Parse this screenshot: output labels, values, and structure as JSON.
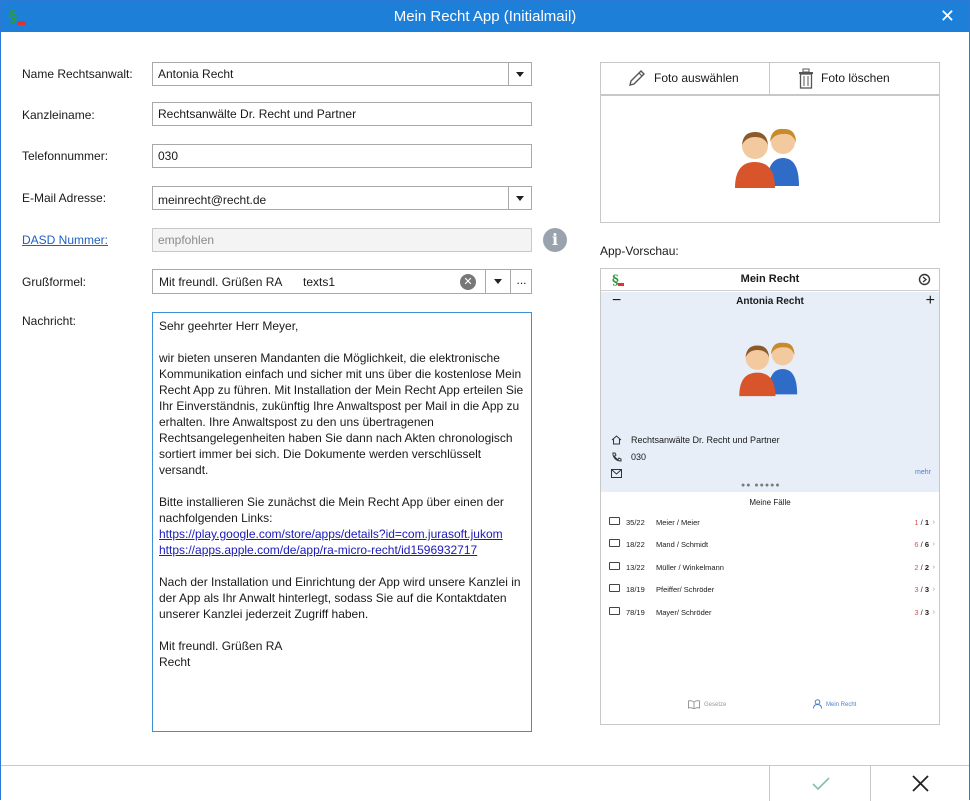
{
  "window": {
    "title": "Mein Recht App (Initialmail)",
    "close_icon": "close-icon"
  },
  "form": {
    "name_label": "Name Rechtsanwalt:",
    "name_value": "Antonia Recht",
    "kanzlei_label": "Kanzleiname:",
    "kanzlei_value": "Rechtsanwälte Dr. Recht und Partner",
    "telefon_label": "Telefonnummer:",
    "telefon_value": "030",
    "email_label": "E-Mail Adresse:",
    "email_value": "meinrecht@recht.de",
    "dasd_label": "DASD Nummer:",
    "dasd_placeholder": "empfohlen",
    "gruss_label": "Grußformel:",
    "gruss_value": "Mit freundl. Grüßen RA",
    "gruss_suffix": "texts1",
    "gruss_more": "...",
    "nachricht_label": "Nachricht:"
  },
  "message": {
    "greeting": "Sehr geehrter Herr Meyer,",
    "para1": "wir bieten unseren Mandanten die Möglichkeit, die elektronische Kommunikation einfach und sicher mit uns über die kostenlose Mein Recht App zu führen. Mit Installation der Mein Recht App erteilen Sie Ihr Einverständnis, zukünftig Ihre Anwaltspost per Mail in die App zu erhalten. Ihre Anwaltspost zu den uns übertragenen Rechtsangelegenheiten haben Sie dann nach Akten chronologisch sortiert immer bei sich. Die Dokumente werden verschlüsselt versandt.",
    "para2": "Bitte installieren Sie zunächst die Mein Recht App über einen der nachfolgenden Links:",
    "link1": "https://play.google.com/store/apps/details?id=com.jurasoft.jukom",
    "link2": "https://apps.apple.com/de/app/ra-micro-recht/id1596932717",
    "para3": "Nach der Installation und Einrichtung der App wird unsere Kanzlei in der App als Ihr Anwalt hinterlegt, sodass Sie auf die Kontaktdaten unserer Kanzlei jederzeit Zugriff haben.",
    "closing": "Mit freundl. Grüßen RA",
    "signature": "Recht"
  },
  "photo": {
    "select_label": "Foto auswählen",
    "delete_label": "Foto löschen"
  },
  "preview": {
    "label": "App-Vorschau:",
    "app_title": "Mein Recht",
    "lawyer": "Antonia Recht",
    "kanzlei": "Rechtsanwälte Dr. Recht und Partner",
    "telefon": "030",
    "mehr": "mehr",
    "cases_title": "Meine Fälle",
    "cases": [
      {
        "nr": "35/22",
        "name": "Meier / Meier",
        "open": "1",
        "total": "1"
      },
      {
        "nr": "18/22",
        "name": "Mand / Schmidt",
        "open": "6",
        "total": "6"
      },
      {
        "nr": "13/22",
        "name": "Müller / Winkelmann",
        "open": "2",
        "total": "2"
      },
      {
        "nr": "18/19",
        "name": "Pfeiffer/ Schröder",
        "open": "3",
        "total": "3"
      },
      {
        "nr": "78/19",
        "name": "Mayer/ Schröder",
        "open": "3",
        "total": "3"
      }
    ],
    "tab_gesetze": "Gesetze",
    "tab_meinrecht": "Mein Recht"
  },
  "colors": {
    "titlebar": "#1e7fd8",
    "accent_red": "#d9534f",
    "link": "#1a1ab8"
  }
}
